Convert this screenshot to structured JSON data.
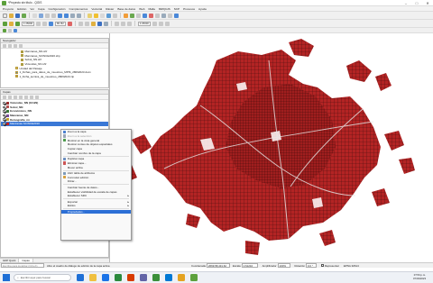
{
  "window": {
    "title": "*Proyecto sin título - QGIS",
    "controls": [
      "–",
      "□",
      "✕"
    ]
  },
  "menubar": [
    "Proyecto",
    "Edición",
    "Ver",
    "Capa",
    "Configuración",
    "Complementos",
    "Vectorial",
    "Ráster",
    "Base de datos",
    "Web",
    "Malla",
    "MMQGIS",
    "SCP",
    "Procesos",
    "Ayuda"
  ],
  "toolbar": {
    "scale_combo": "1:25000",
    "band_combo": "B1 B2",
    "scale_combo_2": "1:25000"
  },
  "navigator": {
    "header": "Navegador",
    "items": [
      "Manzanas_NN.shf",
      "Manzanas_SCINCE2020.shp",
      "Sobol_NN.shf",
      "Viviendas_NN.shf",
      "Unidad del Paisaje",
      "1_Fichas_para_datos_de_muestreo_MPIS_28062023.docx",
      "1_Ficha_tecnica_de_muestreo_28062023.zip"
    ]
  },
  "layers": {
    "header": "Capas",
    "items": [
      {
        "label": "Viviendas_NN (10129)",
        "swatch": "#9b2f2f",
        "checked": true
      },
      {
        "label": "Sobol_NN",
        "swatch": "#b55050",
        "checked": true
      },
      {
        "label": "Económicos_NN",
        "swatch": "#3d7a3d",
        "checked": true
      },
      {
        "label": "Manzanas_NN",
        "swatch": "#7a4a9a",
        "checked": true
      },
      {
        "label": "Demografía_nn",
        "swatch": "#c8a530",
        "checked": true
      },
      {
        "label": "Manzanas SCINCE2010",
        "swatch": "#c62020",
        "checked": true,
        "selected": true
      }
    ]
  },
  "context_menu": {
    "items": [
      {
        "label": "Zoom a la capa",
        "icon": "#4a7fcf"
      },
      {
        "label": "Zoom a la selección",
        "icon": "#9aa6b8",
        "disabled": true
      },
      {
        "label": "Mostrar en la vista general",
        "icon": "#4a9a4a"
      },
      {
        "label": "Mostrar conteo de objetos espaciales",
        "icon": ""
      },
      {
        "label": "Copiar capa",
        "icon": ""
      },
      {
        "label": "Cambiar nombre de la capa",
        "icon": ""
      },
      {
        "sep": true
      },
      {
        "label": "Duplicar capa",
        "icon": "#6c8fc0"
      },
      {
        "label": "Eliminar capa...",
        "icon": "#c55"
      },
      {
        "label": "Mover arriba",
        "icon": ""
      },
      {
        "sep": true
      },
      {
        "label": "Abrir tabla de atributos",
        "icon": "#7c9ab8"
      },
      {
        "label": "Conmutar edición",
        "icon": "#d6a040"
      },
      {
        "label": "Filtrar...",
        "icon": ""
      },
      {
        "sep": true
      },
      {
        "label": "Cambiar fuente de datos...",
        "icon": ""
      },
      {
        "label": "Establecer visibilidad de escala de capas",
        "icon": ""
      },
      {
        "label": "Establecer SRC",
        "icon": "",
        "submenu": true
      },
      {
        "sep": true
      },
      {
        "label": "Exportar",
        "icon": "",
        "submenu": true
      },
      {
        "label": "Estilos",
        "icon": "",
        "submenu": true
      },
      {
        "sep": true
      },
      {
        "label": "Propiedades...",
        "icon": "",
        "highlighted": true
      }
    ]
  },
  "bottom_tabs": [
    "GDP Quick",
    "Capas"
  ],
  "statusbar": {
    "locator_placeholder": "Escriba para localizar (Ctrl+K)",
    "message": "Abre el cuadro de diálogo de edición de la capa activa",
    "coord_label": "Coordenada",
    "coord_value": "2669.58,431.62",
    "scale_label": "Escala",
    "scale_value": "1:61210",
    "magnifier_label": "Amplificador",
    "magnifier_value": "100%",
    "rotation_label": "Rotación",
    "rotation_value": "0.0 °",
    "render_label": "Representar",
    "crs": "EPSG:32614"
  },
  "taskbar": {
    "search_placeholder": "Escribir aquí para buscar",
    "time": "07:53 p.m.",
    "date": "07/03/2023",
    "icons": [
      "#1e6fd6",
      "#f0c040",
      "#1a73e8",
      "#2b8a3e",
      "#d83b01",
      "#6264a7",
      "#3a8f3a",
      "#0078d4",
      "#e4a322",
      "#5ca03c"
    ]
  },
  "map": {
    "fill": "#b32424",
    "dark": "#4a0d0d"
  }
}
